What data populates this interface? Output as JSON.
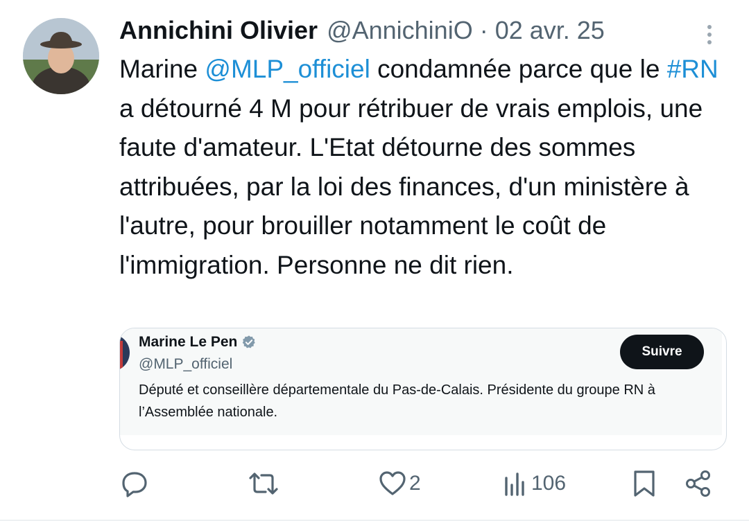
{
  "tweet": {
    "author_name": "Annichini Olivier",
    "author_handle": "@AnnichiniO",
    "separator": "·",
    "date": "02 avr. 25",
    "text": {
      "t1": "Marine ",
      "mention": "@MLP_officiel",
      "t2": " condamnée parce que le ",
      "hashtag": "#RN",
      "t3": " a détourné 4 M pour rétribuer de vrais emplois, une faute d'amateur. L'Etat détourne des sommes attribuées, par la loi des finances, d'un ministère à l'autre, pour brouiller notamment le coût de l'immigration. Personne ne dit rien."
    }
  },
  "card": {
    "name": "Marine Le Pen",
    "handle": "@MLP_officiel",
    "follow_label": "Suivre",
    "bio": "Député et conseillère départementale du Pas-de-Calais. Présidente du groupe RN à l’Assemblée nationale."
  },
  "actions": {
    "likes": "2",
    "views": "106"
  },
  "icons": {
    "reply": "reply-icon",
    "retweet": "retweet-icon",
    "like": "heart-icon",
    "views": "views-icon",
    "bookmark": "bookmark-icon",
    "share": "share-icon",
    "more": "more-icon",
    "verified": "verified-icon"
  },
  "colors": {
    "link": "#1d8fd6",
    "muted": "#536471",
    "text": "#0f1419",
    "follow_bg": "#0f1419"
  }
}
